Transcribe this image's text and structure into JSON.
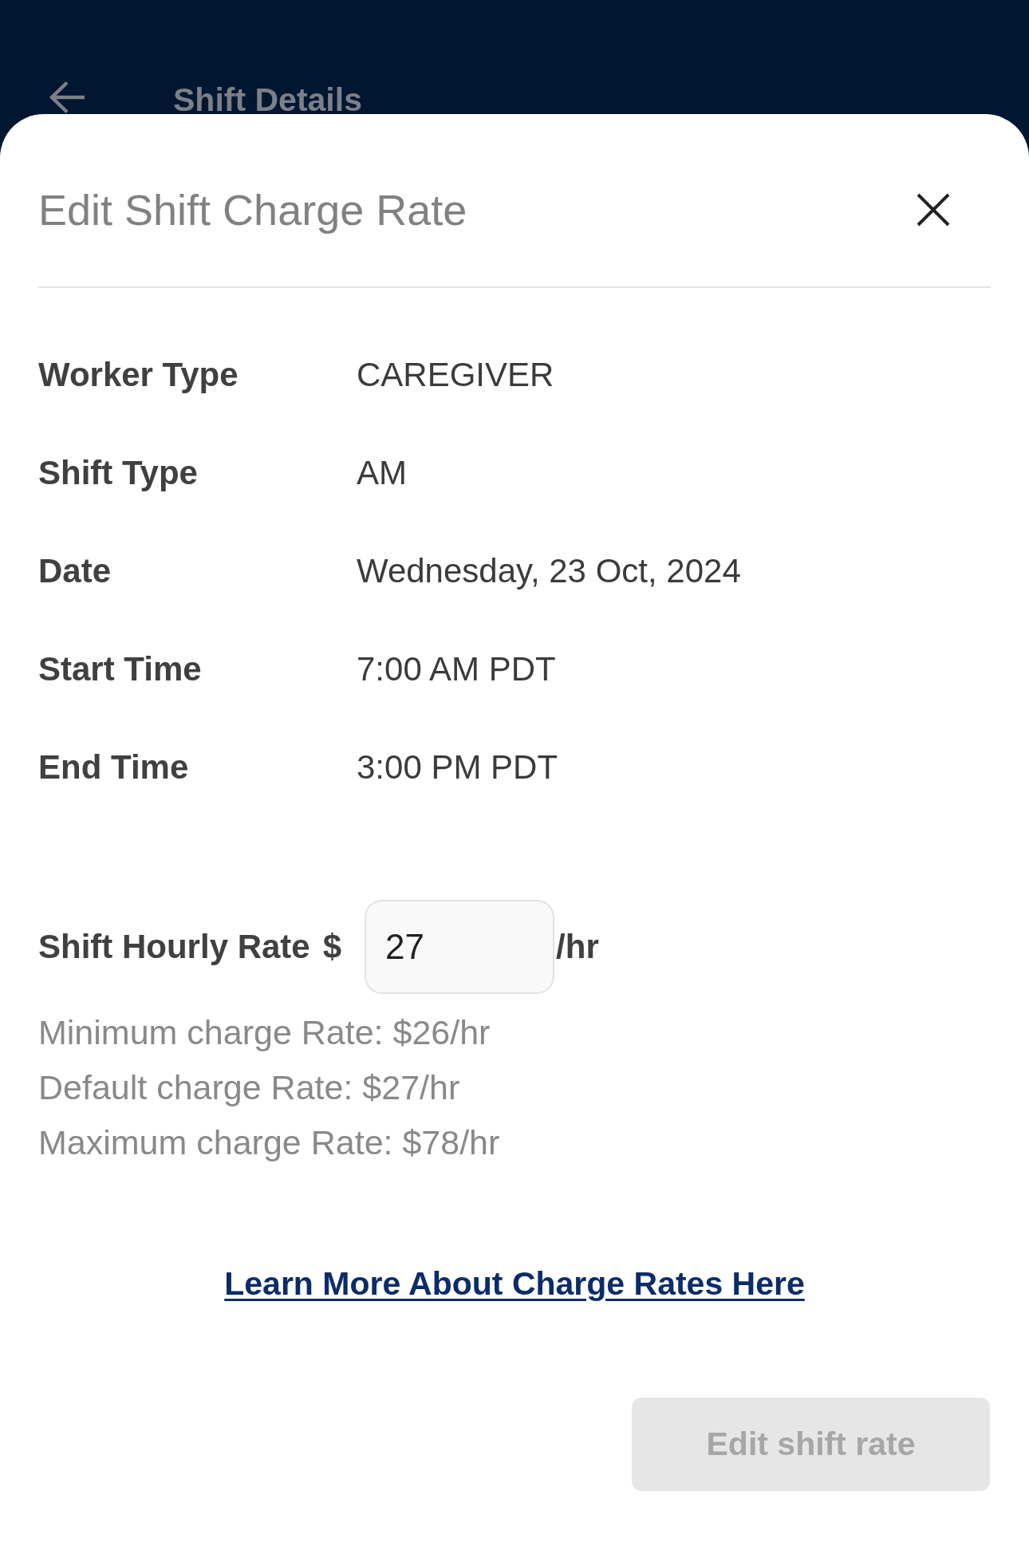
{
  "header": {
    "title": "Shift Details"
  },
  "sheet": {
    "title": "Edit Shift Charge Rate"
  },
  "details": [
    {
      "label": "Worker Type",
      "value": "CAREGIVER"
    },
    {
      "label": "Shift Type",
      "value": "AM"
    },
    {
      "label": "Date",
      "value": "Wednesday, 23 Oct, 2024"
    },
    {
      "label": "Start Time",
      "value": "7:00 AM PDT"
    },
    {
      "label": "End Time",
      "value": "3:00 PM PDT"
    }
  ],
  "rate": {
    "label": "Shift Hourly Rate",
    "currency": "$",
    "value": "27",
    "unit": "/hr"
  },
  "rate_limits": [
    "Minimum charge Rate: $26/hr",
    "Default charge Rate: $27/hr",
    "Maximum charge Rate: $78/hr"
  ],
  "link": "Learn More About Charge Rates Here",
  "submit_button": {
    "label": "Edit shift rate",
    "disabled": true
  }
}
